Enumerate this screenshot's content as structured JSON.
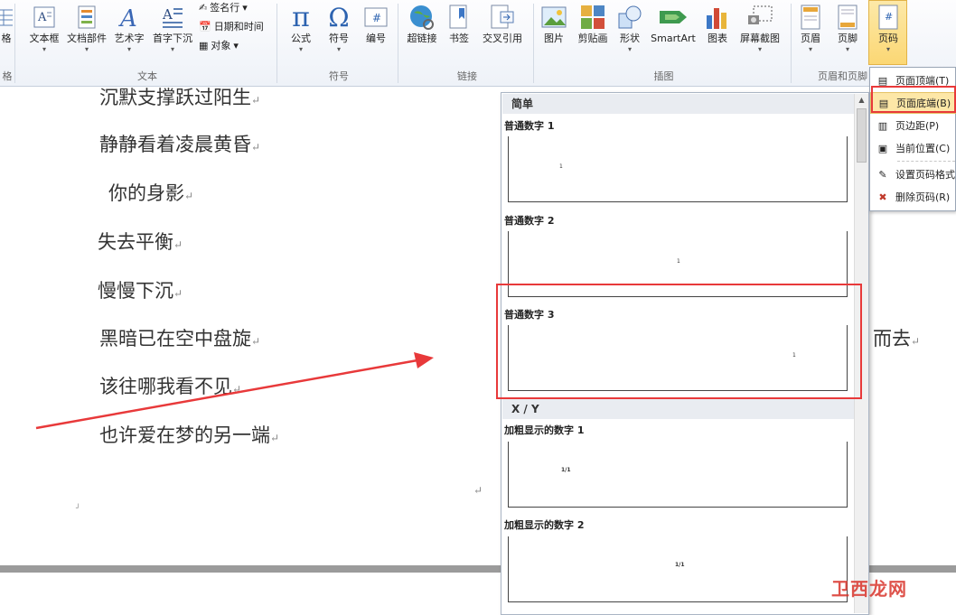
{
  "ribbon": {
    "buttons": {
      "table_partial": "格",
      "textbox": "文本框",
      "quickparts": "文档部件",
      "wordart": "艺术字",
      "dropcap": "首字下沉",
      "equation": "公式",
      "symbol": "符号",
      "number": "编号",
      "hyperlink": "超链接",
      "bookmark": "书签",
      "crossref": "交叉引用",
      "picture": "图片",
      "clipart": "剪贴画",
      "shapes": "形状",
      "smartart": "SmartArt",
      "chart": "图表",
      "screenshot": "屏幕截图",
      "header": "页眉",
      "footer": "页脚",
      "pagenumber": "页码"
    },
    "small": {
      "signature": "签名行",
      "datetime": "日期和时间",
      "object": "对象"
    },
    "groups": {
      "table_partial": "格",
      "text": "文本",
      "symbols": "符号",
      "links": "链接",
      "illustrations": "插图",
      "headerfooter": "页眉和页脚"
    }
  },
  "document": {
    "lines": [
      "沉默支撑跃过阳生",
      "静静看着凌晨黄昏",
      "你的身影",
      "失去平衡",
      "慢慢下沉",
      "黑暗已在空中盘旋",
      "该往哪我看不见",
      "也许爱在梦的另一端"
    ],
    "hidden_tail": "而去",
    "para_mark": "↵",
    "small_mark": "┘"
  },
  "gallery": {
    "section_simple": "简单",
    "section_xy": "X / Y",
    "items": [
      {
        "name": "普通数字 1",
        "sample": "1"
      },
      {
        "name": "普通数字 2",
        "sample": "1"
      },
      {
        "name": "普通数字 3",
        "sample": "1"
      },
      {
        "name": "加粗显示的数字 1",
        "sample": "1/1"
      },
      {
        "name": "加粗显示的数字 2",
        "sample": "1/1"
      }
    ]
  },
  "menu": {
    "items": [
      "页面顶端(T)",
      "页面底端(B)",
      "页边距(P)",
      "当前位置(C)",
      "设置页码格式",
      "删除页码(R)"
    ],
    "highlighted": "页面底端(B)"
  },
  "watermark": "卫西龙网",
  "colors": {
    "highlight": "#e8393a",
    "menu_hover": "#fde7a7"
  }
}
